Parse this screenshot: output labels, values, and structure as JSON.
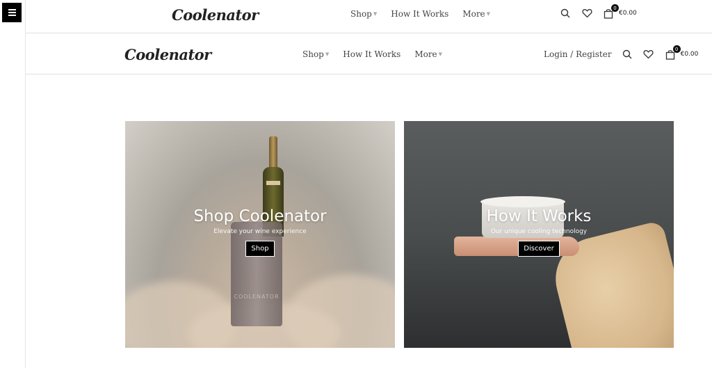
{
  "left_rail": {
    "menu_icon": "hamburger-icon"
  },
  "header_top": {
    "logo": "Coolenator",
    "nav": [
      {
        "label": "Shop",
        "has_dropdown": true
      },
      {
        "label": "How It Works",
        "has_dropdown": false
      },
      {
        "label": "More",
        "has_dropdown": true
      }
    ],
    "search_icon": "search-icon",
    "wishlist_icon": "heart-icon",
    "cart_icon": "bag-icon",
    "cart_count": "0",
    "cart_total": "€0.00"
  },
  "header_main": {
    "logo": "Coolenator",
    "nav": [
      {
        "label": "Shop",
        "has_dropdown": true
      },
      {
        "label": "How It Works",
        "has_dropdown": false
      },
      {
        "label": "More",
        "has_dropdown": true
      }
    ],
    "login_label": "Login / Register",
    "search_icon": "search-icon",
    "wishlist_icon": "heart-icon",
    "cart_icon": "bag-icon",
    "cart_count": "0",
    "cart_total": "€0.00"
  },
  "promos": [
    {
      "title": "Shop Coolenator",
      "subtitle": "Elevate your wine experience",
      "button": "Shop",
      "product_mark": "COOLENATOR"
    },
    {
      "title": "How It Works",
      "subtitle": "Our unique cooling technology",
      "button": "Discover"
    }
  ],
  "colors": {
    "accent": "#000000",
    "text": "#444444",
    "border": "#e0e0e0"
  }
}
